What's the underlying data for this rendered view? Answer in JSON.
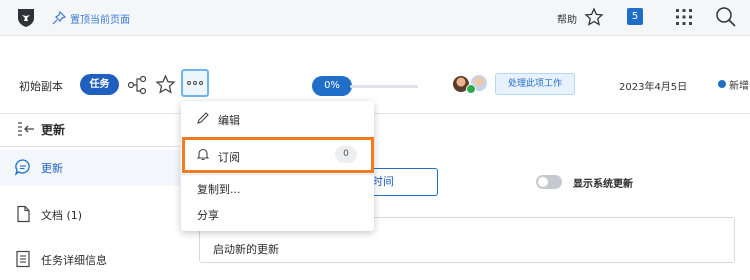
{
  "topbar": {
    "pin_label": "置顶当前页面",
    "help_label": "帮助",
    "notification_count": "5"
  },
  "header": {
    "title": "初始副本",
    "task_badge": "任务",
    "progress": "0%",
    "progress_value": 0,
    "work_button": "处理此项工作",
    "date": "2023年4月5日",
    "status_label": "新增"
  },
  "sidebar": {
    "title": "更新",
    "items": [
      {
        "label": "更新",
        "icon": "comment-icon"
      },
      {
        "label": "文档 (1)",
        "icon": "document-icon"
      },
      {
        "label": "任务详细信息",
        "icon": "details-icon"
      }
    ]
  },
  "main": {
    "time_field": "时间",
    "toggle_label": "显示系统更新",
    "update_placeholder": "启动新的更新"
  },
  "menu": {
    "items": [
      {
        "label": "编辑",
        "icon": "pencil-icon"
      },
      {
        "label": "订阅",
        "icon": "bell-icon",
        "count": "0"
      },
      {
        "label": "复制到..."
      },
      {
        "label": "分享"
      }
    ]
  },
  "colors": {
    "accent": "#1f6fc8",
    "highlight": "#f07b21",
    "success": "#2fa84f"
  }
}
